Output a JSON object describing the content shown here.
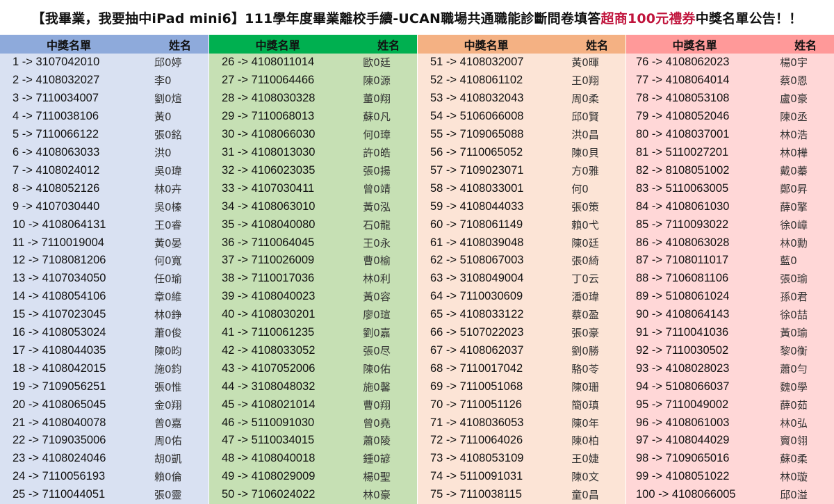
{
  "title": {
    "part1": "【我畢業，我要抽中iPad mini6】111學年度畢業離校手續-UCAN職場共通職能診斷問卷填答 ",
    "highlight": "超商100元禮券",
    "part2": " 中獎名單公告！！"
  },
  "colors": {
    "highlight_text": "#c0143c",
    "group_headers": [
      "#8eaadb",
      "#00b050",
      "#f4b183",
      "#ff9999"
    ],
    "group_bodies": [
      "#d9e1f2",
      "#c6e0b4",
      "#fce4d6",
      "#ffd7d7"
    ]
  },
  "groups": [
    {
      "header_code": "中獎名單",
      "header_name": "姓名",
      "rows": [
        {
          "code": "1 -> 3107042010",
          "name": "邱0婷"
        },
        {
          "code": "2 -> 4108032027",
          "name": "李0"
        },
        {
          "code": "3 -> 7110034007",
          "name": "劉0煊"
        },
        {
          "code": "4 -> 7110038106",
          "name": "黃0"
        },
        {
          "code": "5 -> 7110066122",
          "name": "張0銘"
        },
        {
          "code": "6 -> 4108063033",
          "name": "洪0"
        },
        {
          "code": "7 -> 4108024012",
          "name": "吳0瑋"
        },
        {
          "code": "8 -> 4108052126",
          "name": "林0卉"
        },
        {
          "code": "9 -> 4107030440",
          "name": "吳0榛"
        },
        {
          "code": "10 -> 4108064131",
          "name": "王0睿"
        },
        {
          "code": "11 -> 7110019004",
          "name": "黃0晏"
        },
        {
          "code": "12 -> 7108081206",
          "name": "何0寬"
        },
        {
          "code": "13 -> 4107034050",
          "name": "任0瑜"
        },
        {
          "code": "14 -> 4108054106",
          "name": "章0維"
        },
        {
          "code": "15 -> 4107023045",
          "name": "林0錚"
        },
        {
          "code": "16 -> 4108053024",
          "name": "蕭0俊"
        },
        {
          "code": "17 -> 4108044035",
          "name": "陳0昀"
        },
        {
          "code": "18 -> 4108042015",
          "name": "施0鈞"
        },
        {
          "code": "19 -> 7109056251",
          "name": "張0惟"
        },
        {
          "code": "20 -> 4108065045",
          "name": "金0翔"
        },
        {
          "code": "21 -> 4108040078",
          "name": "曾0嘉"
        },
        {
          "code": "22 -> 7109035006",
          "name": "周0佑"
        },
        {
          "code": "23 -> 4108024046",
          "name": "胡0凱"
        },
        {
          "code": "24 -> 7110056193",
          "name": "賴0倫"
        },
        {
          "code": "25 -> 7110044051",
          "name": "張0靈"
        }
      ]
    },
    {
      "header_code": "中獎名單",
      "header_name": "姓名",
      "rows": [
        {
          "code": "26 -> 4108011014",
          "name": "歐0廷"
        },
        {
          "code": "27 -> 7110064466",
          "name": "陳0源"
        },
        {
          "code": "28 -> 4108030328",
          "name": "董0翔"
        },
        {
          "code": "29 -> 7110068013",
          "name": "蘇0凡"
        },
        {
          "code": "30 -> 4108066030",
          "name": "何0璋"
        },
        {
          "code": "31 -> 4108013030",
          "name": "許0皓"
        },
        {
          "code": "32 -> 4106023035",
          "name": "張0揚"
        },
        {
          "code": "33 -> 4107030411",
          "name": "曾0靖"
        },
        {
          "code": "34 -> 4108063010",
          "name": "黃0泓"
        },
        {
          "code": "35 -> 4108040080",
          "name": "石0龍"
        },
        {
          "code": "36 -> 7110064045",
          "name": "王0永"
        },
        {
          "code": "37 -> 7110026009",
          "name": "曹0榆"
        },
        {
          "code": "38 -> 7110017036",
          "name": "林0利"
        },
        {
          "code": "39 -> 4108040023",
          "name": "黃0容"
        },
        {
          "code": "40 -> 4108030201",
          "name": "廖0瑄"
        },
        {
          "code": "41 -> 7110061235",
          "name": "劉0嘉"
        },
        {
          "code": "42 -> 4108033052",
          "name": "張0尽"
        },
        {
          "code": "43 -> 4107052006",
          "name": "陳0佑"
        },
        {
          "code": "44 -> 3108048032",
          "name": "施0馨"
        },
        {
          "code": "45 -> 4108021014",
          "name": "曹0翔"
        },
        {
          "code": "46 -> 5110091030",
          "name": "曾0堯"
        },
        {
          "code": "47 -> 5110034015",
          "name": "蕭0陵"
        },
        {
          "code": "48 -> 4108040018",
          "name": "鍾0諺"
        },
        {
          "code": "49 -> 4108029009",
          "name": "楊0聖"
        },
        {
          "code": "50 -> 7106024022",
          "name": "林0豪"
        }
      ]
    },
    {
      "header_code": "中獎名單",
      "header_name": "姓名",
      "rows": [
        {
          "code": "51 -> 4108032007",
          "name": "黃0暉"
        },
        {
          "code": "52 -> 4108061102",
          "name": "王0翔"
        },
        {
          "code": "53 -> 4108032043",
          "name": "周0柔"
        },
        {
          "code": "54 -> 5106066008",
          "name": "邱0賢"
        },
        {
          "code": "55 -> 7109065088",
          "name": "洪0昌"
        },
        {
          "code": "56 -> 7110065052",
          "name": "陳0貝"
        },
        {
          "code": "57 -> 7109023071",
          "name": "方0雅"
        },
        {
          "code": "58 -> 4108033001",
          "name": "何0"
        },
        {
          "code": "59 -> 4108044033",
          "name": "張0策"
        },
        {
          "code": "60 -> 7108061149",
          "name": "賴0弋"
        },
        {
          "code": "61 -> 4108039048",
          "name": "陳0廷"
        },
        {
          "code": "62 -> 5108067003",
          "name": "張0綺"
        },
        {
          "code": "63 -> 3108049004",
          "name": "丁0云"
        },
        {
          "code": "64 -> 7110030609",
          "name": "潘0瑋"
        },
        {
          "code": "65 -> 4108033122",
          "name": "蔡0盈"
        },
        {
          "code": "66 -> 5107022023",
          "name": "張0豪"
        },
        {
          "code": "67 -> 4108062037",
          "name": "劉0勝"
        },
        {
          "code": "68 -> 7110017042",
          "name": "駱0苓"
        },
        {
          "code": "69 -> 7110051068",
          "name": "陳0珊"
        },
        {
          "code": "70 -> 7110051126",
          "name": "簡0瑱"
        },
        {
          "code": "71 -> 4108036053",
          "name": "陳0年"
        },
        {
          "code": "72 -> 7110064026",
          "name": "陳0柏"
        },
        {
          "code": "73 -> 4108053109",
          "name": "王0婕"
        },
        {
          "code": "74 -> 5110091031",
          "name": "陳0文"
        },
        {
          "code": "75 -> 7110038115",
          "name": "童0昌"
        }
      ]
    },
    {
      "header_code": "中獎名單",
      "header_name": "姓名",
      "rows": [
        {
          "code": "76 -> 4108062023",
          "name": "楊0宇"
        },
        {
          "code": "77 -> 4108064014",
          "name": "蔡0恩"
        },
        {
          "code": "78 -> 4108053108",
          "name": "盧0豪"
        },
        {
          "code": "79 -> 4108052046",
          "name": "陳0丞"
        },
        {
          "code": "80 -> 4108037001",
          "name": "林0浩"
        },
        {
          "code": "81 -> 5110027201",
          "name": "林0樺"
        },
        {
          "code": "82 -> 8108051002",
          "name": "戴0蓁"
        },
        {
          "code": "83 -> 5110063005",
          "name": "鄭0昇"
        },
        {
          "code": "84 -> 4108061030",
          "name": "薛0擎"
        },
        {
          "code": "85 -> 7110093022",
          "name": "徐0嶂"
        },
        {
          "code": "86 -> 4108063028",
          "name": "林0勳"
        },
        {
          "code": "87 -> 7108011017",
          "name": "藍0"
        },
        {
          "code": "88 -> 7106081106",
          "name": "張0瑜"
        },
        {
          "code": "89 -> 5108061024",
          "name": "孫0君"
        },
        {
          "code": "90 -> 4108064143",
          "name": "徐0喆"
        },
        {
          "code": "91 -> 7110041036",
          "name": "黃0瑜"
        },
        {
          "code": "92 -> 7110030502",
          "name": "黎0衡"
        },
        {
          "code": "93 -> 4108028023",
          "name": "蕭0勻"
        },
        {
          "code": "94 -> 5108066037",
          "name": "魏0學"
        },
        {
          "code": "95 -> 7110049002",
          "name": "薛0茹"
        },
        {
          "code": "96 -> 4108061003",
          "name": "林0弘"
        },
        {
          "code": "97 -> 4108044029",
          "name": "竇0翎"
        },
        {
          "code": "98 -> 7109065016",
          "name": "蘇0柔"
        },
        {
          "code": "99 -> 4108051022",
          "name": "林0璇"
        },
        {
          "code": "100 -> 4108066005",
          "name": "邱0溢"
        }
      ]
    }
  ]
}
